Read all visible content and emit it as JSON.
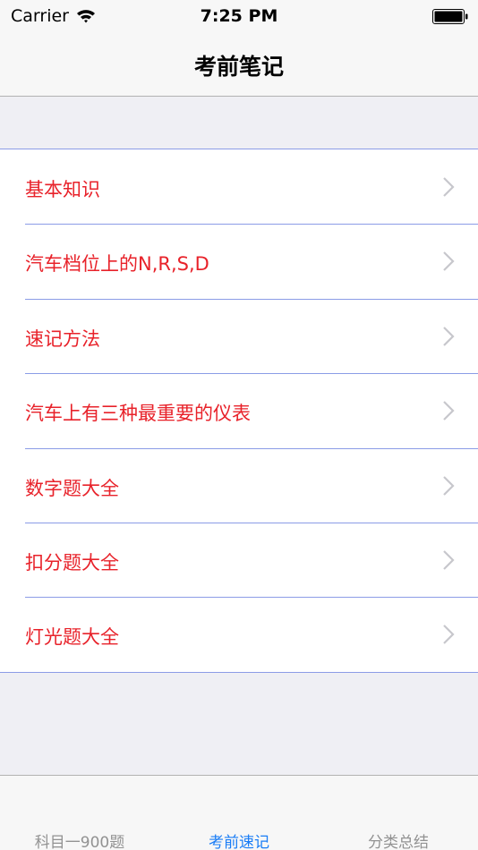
{
  "status_bar": {
    "carrier": "Carrier",
    "time": "7:25 PM"
  },
  "nav": {
    "title": "考前笔记"
  },
  "list": {
    "items": [
      {
        "label": "基本知识"
      },
      {
        "label": "汽车档位上的N,R,S,D"
      },
      {
        "label": "速记方法"
      },
      {
        "label": "汽车上有三种最重要的仪表"
      },
      {
        "label": "数字题大全"
      },
      {
        "label": "扣分题大全"
      },
      {
        "label": "灯光题大全"
      }
    ]
  },
  "tab_bar": {
    "tabs": [
      {
        "label": "科目一900题",
        "active": false
      },
      {
        "label": "考前速记",
        "active": true
      },
      {
        "label": "分类总结",
        "active": false
      }
    ]
  },
  "colors": {
    "accent": "#1a7df6",
    "item_text": "#e8222a",
    "separator": "#8b9ce6"
  }
}
